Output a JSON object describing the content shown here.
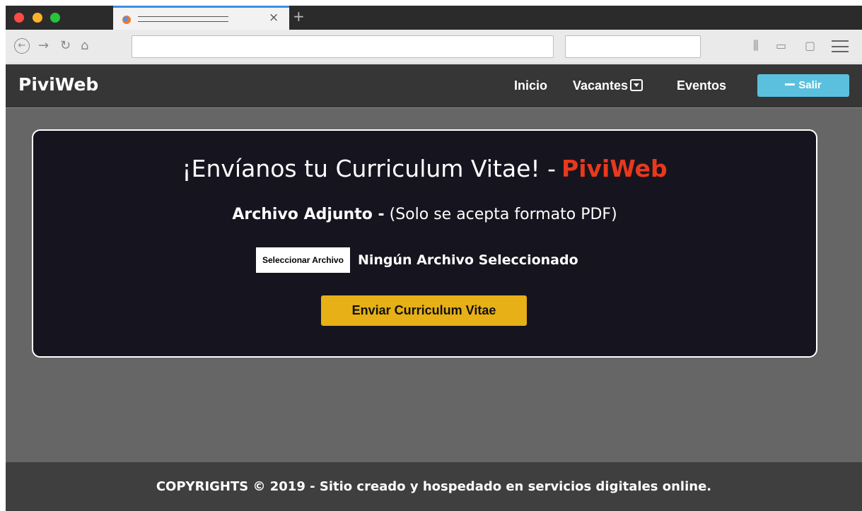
{
  "browser": {
    "tab_close_glyph": "×",
    "new_tab_glyph": "+",
    "url_value": "",
    "search_value": "",
    "icons": [
      "back-icon",
      "forward-icon",
      "reload-icon",
      "home-icon",
      "library-icon",
      "reader-icon",
      "sidebar-icon",
      "menu-icon"
    ]
  },
  "header": {
    "brand": "PiviWeb",
    "nav": {
      "inicio": "Inicio",
      "vacantes": "Vacantes",
      "eventos": "Eventos"
    },
    "logout_label": "Salir"
  },
  "card": {
    "title": "¡Envíanos tu Curriculum Vitae! -",
    "title_accent": "PiviWeb",
    "attach_label": "Archivo Adjunto -",
    "attach_note": "(Solo se acepta formato PDF)",
    "file_button": "Seleccionar Archivo",
    "file_status": "Ningún Archivo Seleccionado",
    "submit_label": "Enviar Curriculum Vitae"
  },
  "footer": {
    "text": "COPYRIGHTS © 2019 - Sitio creado y hospedado en servicios digitales online."
  },
  "colors": {
    "header_bg": "#363636",
    "page_bg": "#666666",
    "card_bg": "#16151f",
    "accent_red": "#e8391d",
    "logout_blue": "#5bc0de",
    "submit_yellow": "#e6b016",
    "footer_bg": "#3f3f3f"
  }
}
